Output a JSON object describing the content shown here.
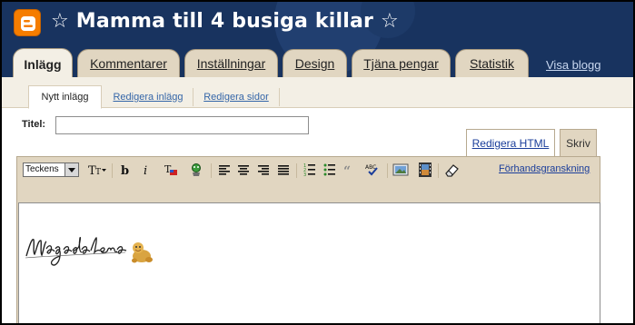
{
  "header": {
    "title": "☆ Mamma till 4 busiga killar ☆",
    "logo_icon": "blogger-logo-icon",
    "brand_color": "#f57d00",
    "background": "#18335f"
  },
  "tabs": [
    {
      "label": "Inlägg",
      "active": true
    },
    {
      "label": "Kommentarer",
      "active": false
    },
    {
      "label": "Inställningar",
      "active": false
    },
    {
      "label": "Design",
      "active": false
    },
    {
      "label": "Tjäna pengar",
      "active": false
    },
    {
      "label": "Statistik",
      "active": false
    }
  ],
  "view_blog_label": "Visa blogg",
  "subtabs": [
    {
      "label": "Nytt inlägg",
      "active": true
    },
    {
      "label": "Redigera inlägg",
      "active": false
    },
    {
      "label": "Redigera sidor",
      "active": false
    }
  ],
  "post": {
    "title_label": "Titel:",
    "title_value": ""
  },
  "mode_tabs": {
    "html_label": "Redigera HTML",
    "compose_label": "Skriv",
    "active": "Skriv"
  },
  "toolbar": {
    "font_value": "Teckensnitt",
    "font_display": "Teckens",
    "preview_label": "Förhandsgranskning",
    "icons": [
      "font-size-icon",
      "bold-icon",
      "italic-icon",
      "text-color-icon",
      "link-icon",
      "align-left-icon",
      "align-center-icon",
      "align-right-icon",
      "justify-icon",
      "numbered-list-icon",
      "bullet-list-icon",
      "quote-icon",
      "spellcheck-icon",
      "image-icon",
      "video-icon",
      "remove-formatting-icon"
    ]
  },
  "editor": {
    "signature_icon": "magdalena-signature-image",
    "signature_text": "Magdalena"
  }
}
